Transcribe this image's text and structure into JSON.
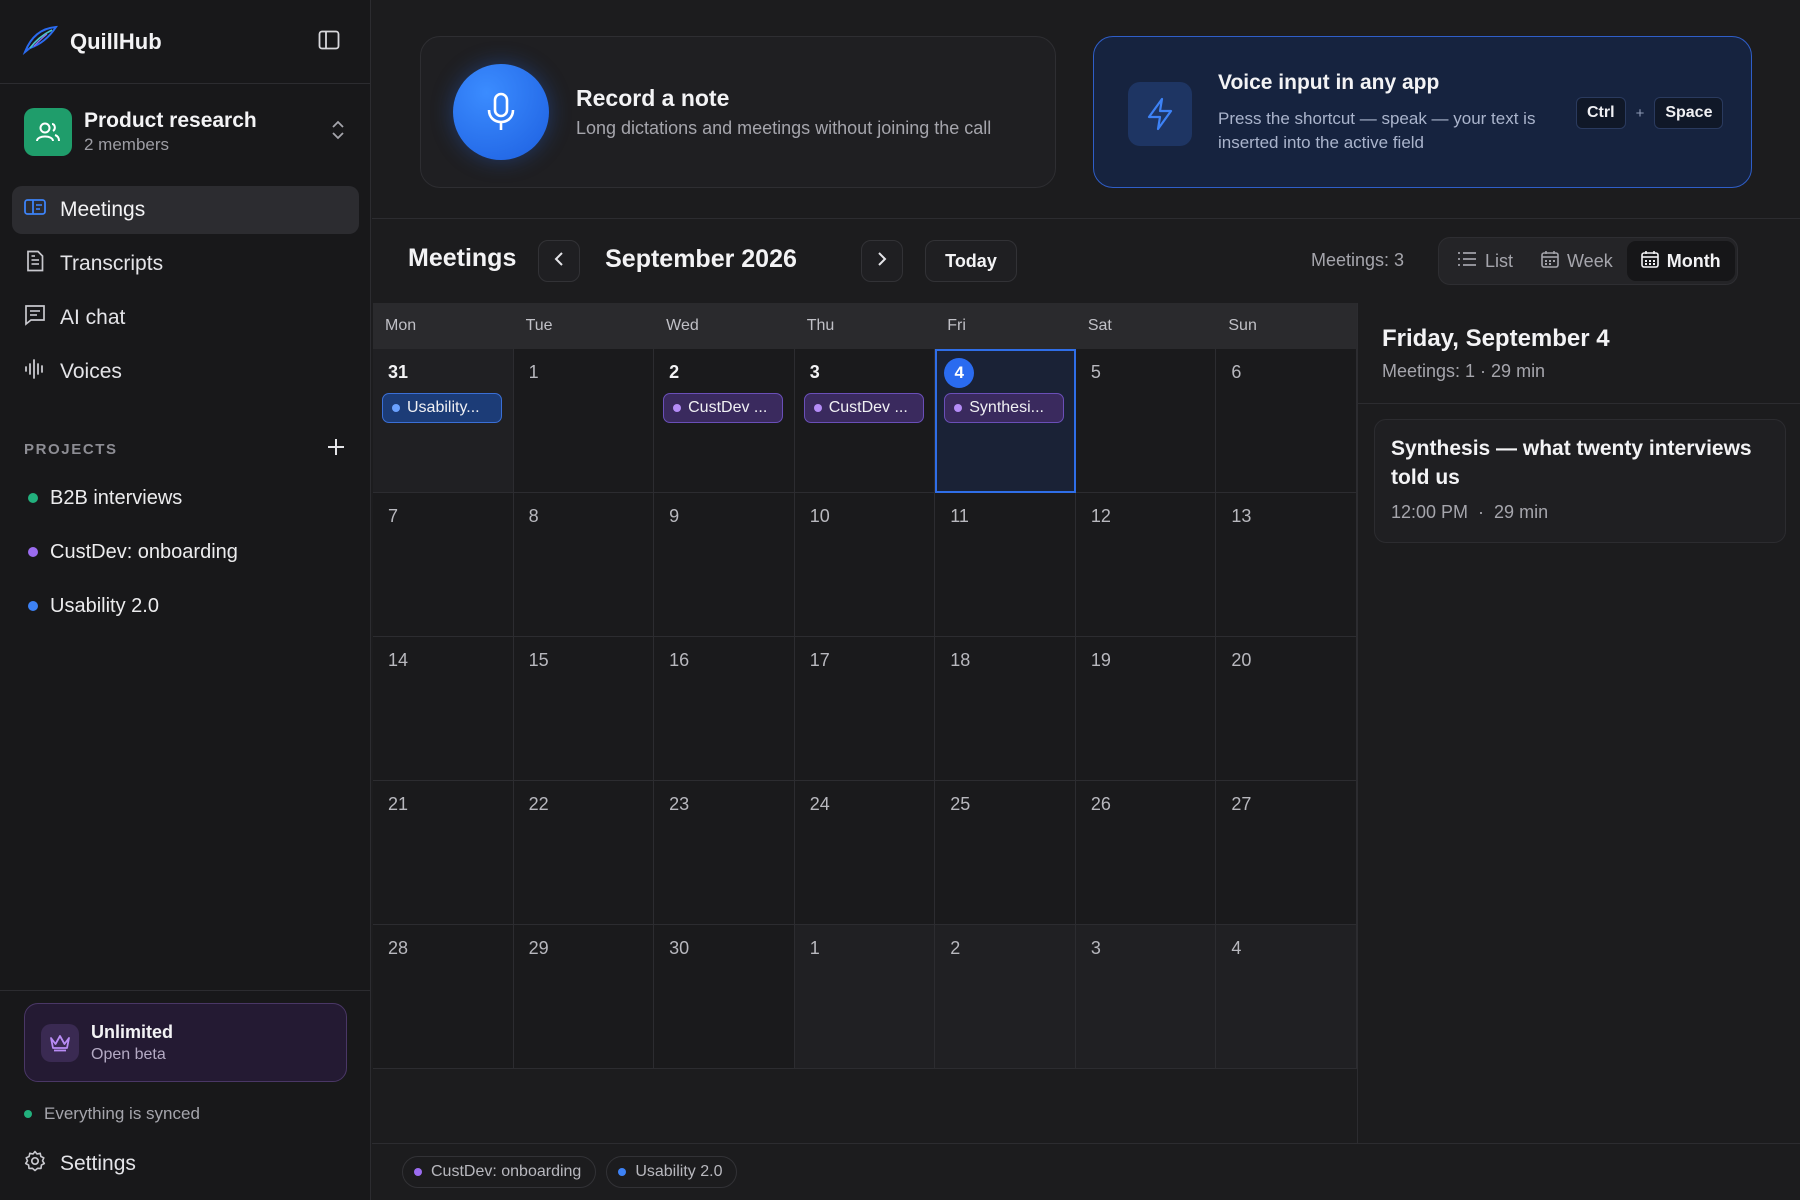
{
  "app": {
    "name": "QuillHub"
  },
  "workspace": {
    "name": "Product research",
    "members": "2 members"
  },
  "nav": [
    {
      "label": "Meetings",
      "icon": "meetings-icon",
      "active": true
    },
    {
      "label": "Transcripts",
      "icon": "document-icon",
      "active": false
    },
    {
      "label": "AI chat",
      "icon": "chat-icon",
      "active": false
    },
    {
      "label": "Voices",
      "icon": "waveform-icon",
      "active": false
    }
  ],
  "projects": {
    "label": "PROJECTS",
    "items": [
      {
        "name": "B2B interviews",
        "color": "#22b07d"
      },
      {
        "name": "CustDev: onboarding",
        "color": "#9b6cf0"
      },
      {
        "name": "Usability 2.0",
        "color": "#3d82f6"
      }
    ]
  },
  "plan": {
    "title": "Unlimited",
    "subtitle": "Open beta"
  },
  "sync_status": "Everything is synced",
  "settings_label": "Settings",
  "record_card": {
    "title": "Record a note",
    "subtitle": "Long dictations and meetings without joining the call"
  },
  "voice_card": {
    "title": "Voice input in any app",
    "subtitle": "Press the shortcut — speak — your text is inserted into the active field",
    "key1": "Ctrl",
    "plus": "+",
    "key2": "Space"
  },
  "toolbar": {
    "title": "Meetings",
    "month": "September 2026",
    "today": "Today",
    "count": "Meetings: 3",
    "views": [
      {
        "label": "List",
        "icon": "list-icon",
        "active": false
      },
      {
        "label": "Week",
        "icon": "calendar-week-icon",
        "active": false
      },
      {
        "label": "Month",
        "icon": "calendar-month-icon",
        "active": true
      }
    ]
  },
  "calendar": {
    "weekdays": [
      "Mon",
      "Tue",
      "Wed",
      "Thu",
      "Fri",
      "Sat",
      "Sun"
    ],
    "weeks": [
      [
        {
          "day": "31",
          "out": true,
          "strong": true,
          "event": {
            "title": "Usability...",
            "color": "blue"
          }
        },
        {
          "day": "1"
        },
        {
          "day": "2",
          "strong": true,
          "event": {
            "title": "CustDev ...",
            "color": "purple"
          }
        },
        {
          "day": "3",
          "strong": true,
          "event": {
            "title": "CustDev ...",
            "color": "purple"
          }
        },
        {
          "day": "4",
          "today": true,
          "selected": true,
          "event": {
            "title": "Synthesi...",
            "color": "purple"
          }
        },
        {
          "day": "5"
        },
        {
          "day": "6"
        }
      ],
      [
        {
          "day": "7"
        },
        {
          "day": "8"
        },
        {
          "day": "9"
        },
        {
          "day": "10"
        },
        {
          "day": "11"
        },
        {
          "day": "12"
        },
        {
          "day": "13"
        }
      ],
      [
        {
          "day": "14"
        },
        {
          "day": "15"
        },
        {
          "day": "16"
        },
        {
          "day": "17"
        },
        {
          "day": "18"
        },
        {
          "day": "19"
        },
        {
          "day": "20"
        }
      ],
      [
        {
          "day": "21"
        },
        {
          "day": "22"
        },
        {
          "day": "23"
        },
        {
          "day": "24"
        },
        {
          "day": "25"
        },
        {
          "day": "26"
        },
        {
          "day": "27"
        }
      ],
      [
        {
          "day": "28"
        },
        {
          "day": "29"
        },
        {
          "day": "30"
        },
        {
          "day": "1",
          "out": true
        },
        {
          "day": "2",
          "out": true
        },
        {
          "day": "3",
          "out": true
        },
        {
          "day": "4",
          "out": true
        }
      ]
    ]
  },
  "day_panel": {
    "title": "Friday, September 4",
    "subtitle": "Meetings: 1 · 29 min",
    "meeting": {
      "title": "Synthesis — what twenty interviews told us",
      "time": "12:00 PM",
      "sep": "·",
      "duration": "29 min"
    }
  },
  "legend": [
    {
      "name": "CustDev: onboarding",
      "color": "#9b6cf0"
    },
    {
      "name": "Usability 2.0",
      "color": "#3d82f6"
    }
  ],
  "colors": {
    "accent": "#2a6bf0",
    "purple": "#9b6cf0",
    "green": "#22b07d",
    "blue": "#3d82f6"
  }
}
